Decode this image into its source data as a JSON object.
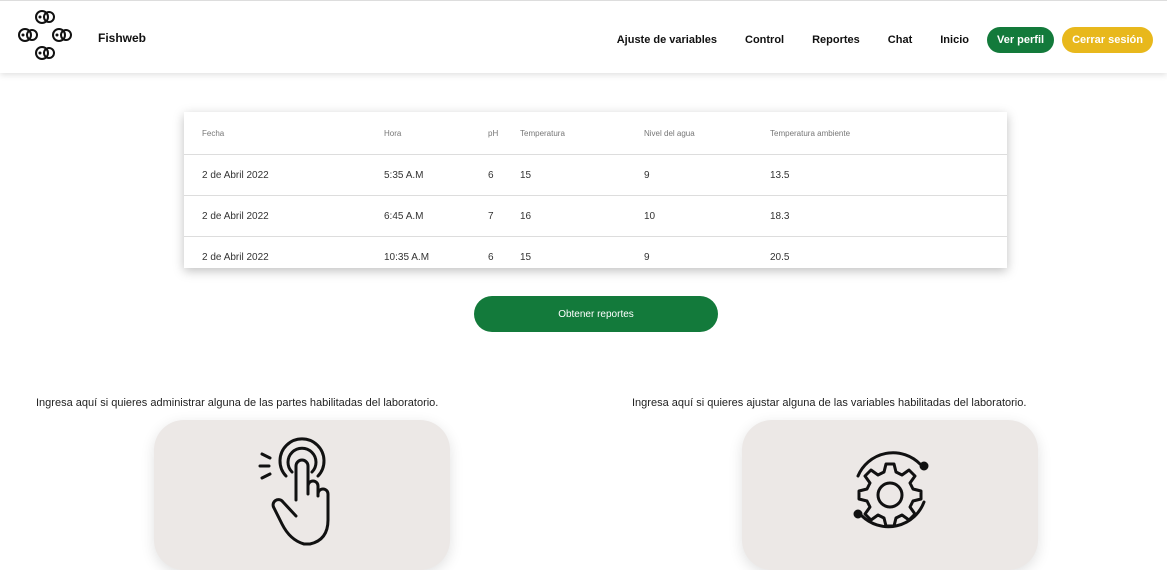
{
  "header": {
    "brand": "Fishweb",
    "nav": [
      "Ajuste de variables",
      "Control",
      "Reportes",
      "Chat",
      "Inicio"
    ],
    "profile_button": "Ver perfil",
    "logout_button": "Cerrar sesión",
    "colors": {
      "green": "#137a3b",
      "yellow": "#e8b81c"
    }
  },
  "table": {
    "headers": [
      "Fecha",
      "Hora",
      "pH",
      "Temperatura",
      "Nivel del agua",
      "Temperatura ambiente"
    ],
    "rows": [
      [
        "2 de Abril 2022",
        "5:35 A.M",
        "6",
        "15",
        "9",
        "13.5"
      ],
      [
        "2 de Abril 2022",
        "6:45 A.M",
        "7",
        "16",
        "10",
        "18.3"
      ],
      [
        "2 de Abril 2022",
        "10:35 A.M",
        "6",
        "15",
        "9",
        "20.5"
      ]
    ]
  },
  "report_button": "Obtener reportes",
  "sections": {
    "control_caption": "Ingresa aquí si quieres administrar alguna de las partes habilitadas del laboratorio.",
    "control_icon": "touch-hand-icon",
    "variables_caption": "Ingresa aquí si quieres ajustar alguna de las variables habilitadas del laboratorio.",
    "variables_icon": "gear-cycle-icon"
  }
}
